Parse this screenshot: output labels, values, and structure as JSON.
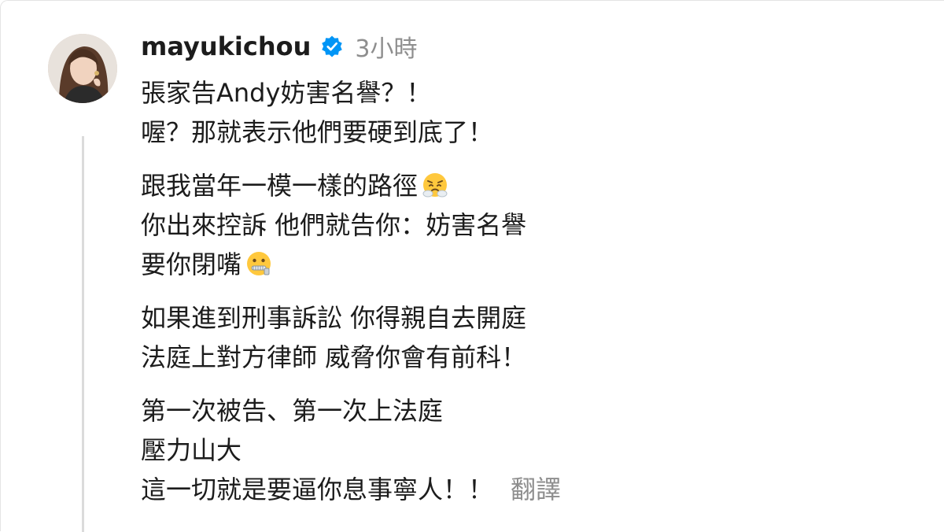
{
  "comment": {
    "username": "mayukichou",
    "verified": true,
    "timestamp": "3小時",
    "paragraphs": [
      [
        "張家告Andy妨害名譽？！",
        "喔？那就表示他們要硬到底了！"
      ],
      [
        "跟我當年一模一樣的路徑",
        "你出來控訴 他們就告你：妨害名譽",
        "要你閉嘴"
      ],
      [
        "如果進到刑事訴訟 你得親自去開庭",
        "法庭上對方律師 威脅你會有前科！"
      ],
      [
        "第一次被告、第一次上法庭",
        "壓力山大",
        "這一切就是要逼你息事寧人！！"
      ]
    ],
    "emojis": {
      "steam_nose": "face-with-steam-from-nose-icon",
      "zipper_mouth": "zipper-mouth-face-icon"
    },
    "translate_label": "翻譯"
  },
  "colors": {
    "text": "#1c1c1c",
    "muted": "#8e8e8e",
    "verified_blue": "#0095f6",
    "thread_line": "#dbdbdb"
  }
}
